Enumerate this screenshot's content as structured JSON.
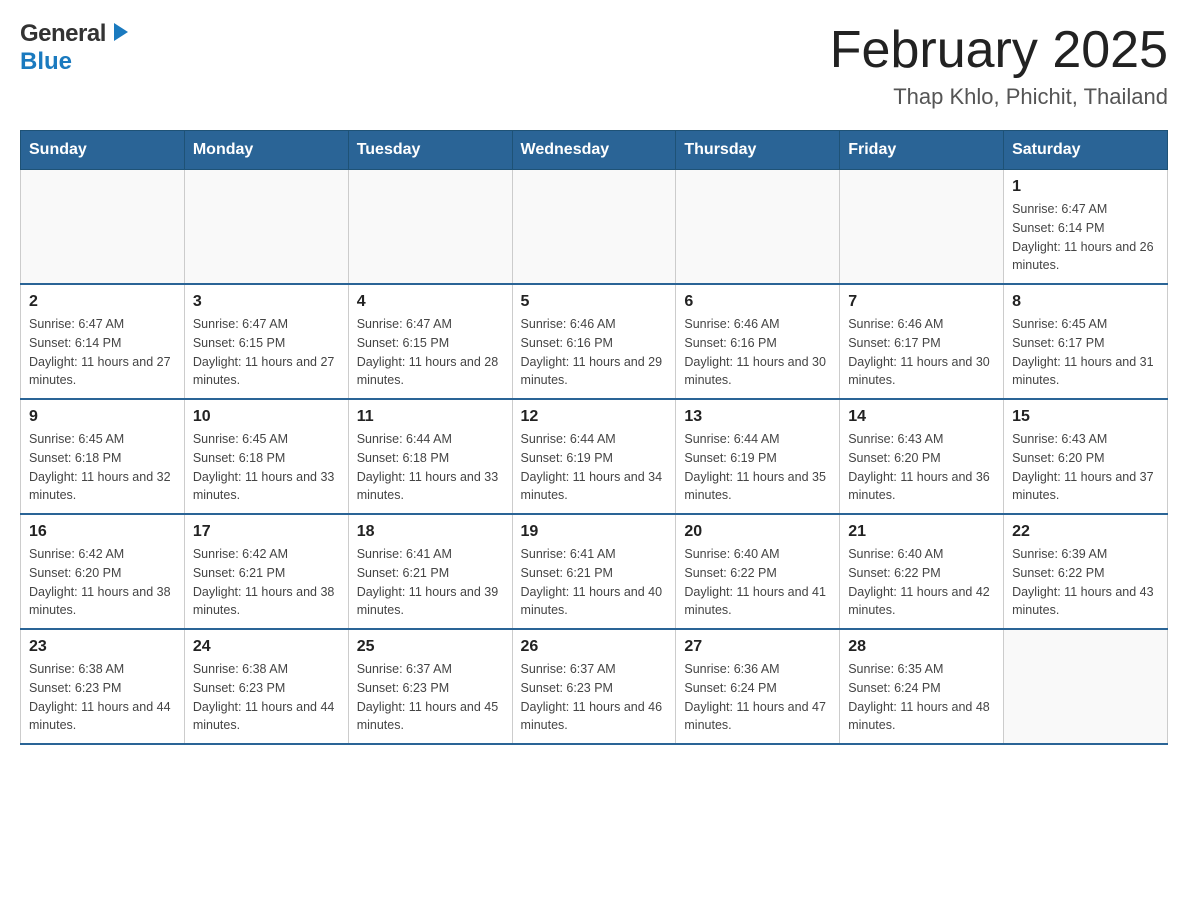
{
  "header": {
    "logo_general": "General",
    "logo_blue": "Blue",
    "calendar_title": "February 2025",
    "calendar_subtitle": "Thap Khlo, Phichit, Thailand"
  },
  "days_of_week": [
    "Sunday",
    "Monday",
    "Tuesday",
    "Wednesday",
    "Thursday",
    "Friday",
    "Saturday"
  ],
  "weeks": [
    [
      {
        "day": "",
        "sunrise": "",
        "sunset": "",
        "daylight": ""
      },
      {
        "day": "",
        "sunrise": "",
        "sunset": "",
        "daylight": ""
      },
      {
        "day": "",
        "sunrise": "",
        "sunset": "",
        "daylight": ""
      },
      {
        "day": "",
        "sunrise": "",
        "sunset": "",
        "daylight": ""
      },
      {
        "day": "",
        "sunrise": "",
        "sunset": "",
        "daylight": ""
      },
      {
        "day": "",
        "sunrise": "",
        "sunset": "",
        "daylight": ""
      },
      {
        "day": "1",
        "sunrise": "Sunrise: 6:47 AM",
        "sunset": "Sunset: 6:14 PM",
        "daylight": "Daylight: 11 hours and 26 minutes."
      }
    ],
    [
      {
        "day": "2",
        "sunrise": "Sunrise: 6:47 AM",
        "sunset": "Sunset: 6:14 PM",
        "daylight": "Daylight: 11 hours and 27 minutes."
      },
      {
        "day": "3",
        "sunrise": "Sunrise: 6:47 AM",
        "sunset": "Sunset: 6:15 PM",
        "daylight": "Daylight: 11 hours and 27 minutes."
      },
      {
        "day": "4",
        "sunrise": "Sunrise: 6:47 AM",
        "sunset": "Sunset: 6:15 PM",
        "daylight": "Daylight: 11 hours and 28 minutes."
      },
      {
        "day": "5",
        "sunrise": "Sunrise: 6:46 AM",
        "sunset": "Sunset: 6:16 PM",
        "daylight": "Daylight: 11 hours and 29 minutes."
      },
      {
        "day": "6",
        "sunrise": "Sunrise: 6:46 AM",
        "sunset": "Sunset: 6:16 PM",
        "daylight": "Daylight: 11 hours and 30 minutes."
      },
      {
        "day": "7",
        "sunrise": "Sunrise: 6:46 AM",
        "sunset": "Sunset: 6:17 PM",
        "daylight": "Daylight: 11 hours and 30 minutes."
      },
      {
        "day": "8",
        "sunrise": "Sunrise: 6:45 AM",
        "sunset": "Sunset: 6:17 PM",
        "daylight": "Daylight: 11 hours and 31 minutes."
      }
    ],
    [
      {
        "day": "9",
        "sunrise": "Sunrise: 6:45 AM",
        "sunset": "Sunset: 6:18 PM",
        "daylight": "Daylight: 11 hours and 32 minutes."
      },
      {
        "day": "10",
        "sunrise": "Sunrise: 6:45 AM",
        "sunset": "Sunset: 6:18 PM",
        "daylight": "Daylight: 11 hours and 33 minutes."
      },
      {
        "day": "11",
        "sunrise": "Sunrise: 6:44 AM",
        "sunset": "Sunset: 6:18 PM",
        "daylight": "Daylight: 11 hours and 33 minutes."
      },
      {
        "day": "12",
        "sunrise": "Sunrise: 6:44 AM",
        "sunset": "Sunset: 6:19 PM",
        "daylight": "Daylight: 11 hours and 34 minutes."
      },
      {
        "day": "13",
        "sunrise": "Sunrise: 6:44 AM",
        "sunset": "Sunset: 6:19 PM",
        "daylight": "Daylight: 11 hours and 35 minutes."
      },
      {
        "day": "14",
        "sunrise": "Sunrise: 6:43 AM",
        "sunset": "Sunset: 6:20 PM",
        "daylight": "Daylight: 11 hours and 36 minutes."
      },
      {
        "day": "15",
        "sunrise": "Sunrise: 6:43 AM",
        "sunset": "Sunset: 6:20 PM",
        "daylight": "Daylight: 11 hours and 37 minutes."
      }
    ],
    [
      {
        "day": "16",
        "sunrise": "Sunrise: 6:42 AM",
        "sunset": "Sunset: 6:20 PM",
        "daylight": "Daylight: 11 hours and 38 minutes."
      },
      {
        "day": "17",
        "sunrise": "Sunrise: 6:42 AM",
        "sunset": "Sunset: 6:21 PM",
        "daylight": "Daylight: 11 hours and 38 minutes."
      },
      {
        "day": "18",
        "sunrise": "Sunrise: 6:41 AM",
        "sunset": "Sunset: 6:21 PM",
        "daylight": "Daylight: 11 hours and 39 minutes."
      },
      {
        "day": "19",
        "sunrise": "Sunrise: 6:41 AM",
        "sunset": "Sunset: 6:21 PM",
        "daylight": "Daylight: 11 hours and 40 minutes."
      },
      {
        "day": "20",
        "sunrise": "Sunrise: 6:40 AM",
        "sunset": "Sunset: 6:22 PM",
        "daylight": "Daylight: 11 hours and 41 minutes."
      },
      {
        "day": "21",
        "sunrise": "Sunrise: 6:40 AM",
        "sunset": "Sunset: 6:22 PM",
        "daylight": "Daylight: 11 hours and 42 minutes."
      },
      {
        "day": "22",
        "sunrise": "Sunrise: 6:39 AM",
        "sunset": "Sunset: 6:22 PM",
        "daylight": "Daylight: 11 hours and 43 minutes."
      }
    ],
    [
      {
        "day": "23",
        "sunrise": "Sunrise: 6:38 AM",
        "sunset": "Sunset: 6:23 PM",
        "daylight": "Daylight: 11 hours and 44 minutes."
      },
      {
        "day": "24",
        "sunrise": "Sunrise: 6:38 AM",
        "sunset": "Sunset: 6:23 PM",
        "daylight": "Daylight: 11 hours and 44 minutes."
      },
      {
        "day": "25",
        "sunrise": "Sunrise: 6:37 AM",
        "sunset": "Sunset: 6:23 PM",
        "daylight": "Daylight: 11 hours and 45 minutes."
      },
      {
        "day": "26",
        "sunrise": "Sunrise: 6:37 AM",
        "sunset": "Sunset: 6:23 PM",
        "daylight": "Daylight: 11 hours and 46 minutes."
      },
      {
        "day": "27",
        "sunrise": "Sunrise: 6:36 AM",
        "sunset": "Sunset: 6:24 PM",
        "daylight": "Daylight: 11 hours and 47 minutes."
      },
      {
        "day": "28",
        "sunrise": "Sunrise: 6:35 AM",
        "sunset": "Sunset: 6:24 PM",
        "daylight": "Daylight: 11 hours and 48 minutes."
      },
      {
        "day": "",
        "sunrise": "",
        "sunset": "",
        "daylight": ""
      }
    ]
  ]
}
